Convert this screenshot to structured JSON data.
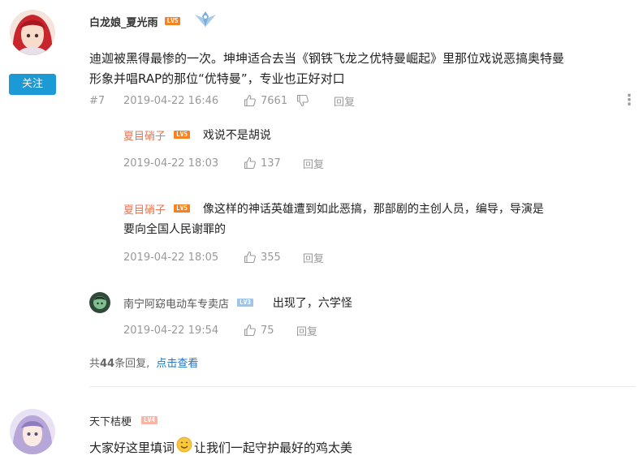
{
  "comment1": {
    "username": "白龙娘_夏光雨",
    "level": "LV5",
    "content_line1": "迪迦被黑得最惨的一次。坤坤适合去当《钢铁飞龙之优特曼崛起》里那位戏说恶搞奥特曼",
    "content_line2": "形象并唱RAP的那位“优特曼”，专业也正好对口",
    "floor": "#7",
    "time": "2019-04-22 16:46",
    "likes": "7661",
    "reply_label": "回复",
    "follow_label": "关注",
    "more_icon": "⋮"
  },
  "replies": [
    {
      "username": "夏目硝子",
      "level": "LV5",
      "text": "戏说不是胡说",
      "time": "2019-04-22 18:03",
      "likes": "137",
      "reply_label": "回复"
    },
    {
      "username": "夏目硝子",
      "level": "LV5",
      "text_line1": "像这样的神话英雄遭到如此恶搞，那部剧的主创人员，编导，导演是",
      "text_line2": "要向全国人民谢罪的",
      "time": "2019-04-22 18:05",
      "likes": "355",
      "reply_label": "回复"
    },
    {
      "username": "南宁阿窈电动车专卖店",
      "level": "LV3",
      "text": "出现了，六学怪",
      "time": "2019-04-22 19:54",
      "likes": "75",
      "reply_label": "回复"
    }
  ],
  "summary": {
    "prefix": "共",
    "count": "44",
    "suffix": "条回复,",
    "link": "点击查看"
  },
  "comment2": {
    "username": "天下桔梗",
    "level": "LV4",
    "content_before": "大家好这里填词",
    "emoji": "😊",
    "content_after": "让我们一起守护最好的鸡太美"
  },
  "colors": {
    "follow_button": "#1c9ad6",
    "link": "#1a74c9",
    "level_orange": "#f58220",
    "level_blue": "#9bc5ec",
    "reply_username": "#eb7350"
  }
}
